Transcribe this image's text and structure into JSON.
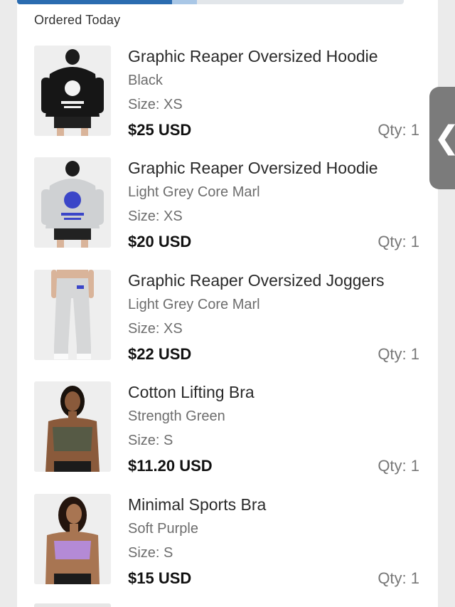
{
  "progress": {
    "fraction": 0.4
  },
  "section": {
    "label": "Ordered Today"
  },
  "items": [
    {
      "name": "Graphic Reaper Oversized Hoodie",
      "variant": "Black",
      "size": "Size: XS",
      "price": "$25 USD",
      "qty": "Qty: 1",
      "thumb_icon": "black-hoodie-back-image"
    },
    {
      "name": "Graphic Reaper Oversized Hoodie",
      "variant": "Light Grey Core Marl",
      "size": "Size: XS",
      "price": "$20 USD",
      "qty": "Qty: 1",
      "thumb_icon": "grey-hoodie-back-image"
    },
    {
      "name": "Graphic Reaper Oversized Joggers",
      "variant": "Light Grey Core Marl",
      "size": "Size: XS",
      "price": "$22 USD",
      "qty": "Qty: 1",
      "thumb_icon": "grey-joggers-image"
    },
    {
      "name": "Cotton Lifting Bra",
      "variant": "Strength Green",
      "size": "Size: S",
      "price": "$11.20 USD",
      "qty": "Qty: 1",
      "thumb_icon": "green-sports-bra-image"
    },
    {
      "name": "Minimal Sports Bra",
      "variant": "Soft Purple",
      "size": "Size: S",
      "price": "$15 USD",
      "qty": "Qty: 1",
      "thumb_icon": "purple-sports-bra-image"
    }
  ],
  "side_tab": {
    "glyph": "❮",
    "icon": "chevron-left-icon"
  },
  "colors": {
    "accent": "#2b6cb0",
    "price": "#111111",
    "muted": "#6d6d6d",
    "tab": "#7b7b7b"
  }
}
